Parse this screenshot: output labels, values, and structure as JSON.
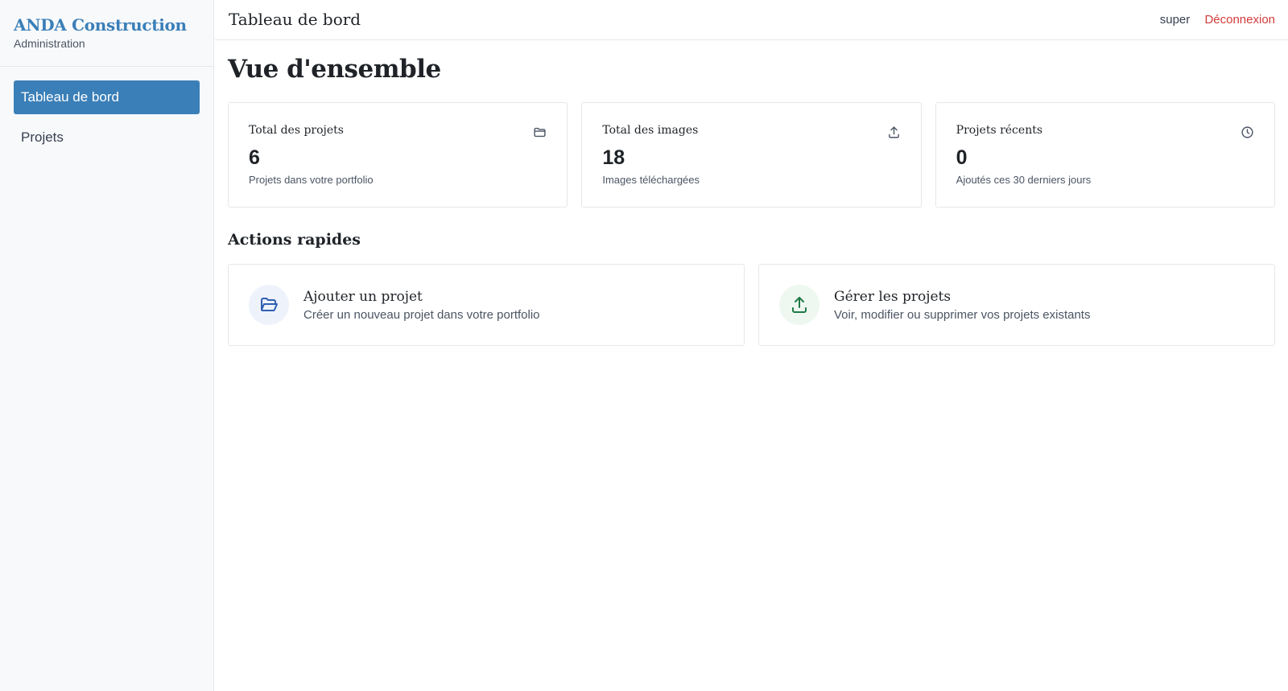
{
  "sidebar": {
    "brand_name": "ANDA Construction",
    "brand_subtitle": "Administration",
    "items": [
      {
        "label": "Tableau de bord",
        "active": true
      },
      {
        "label": "Projets",
        "active": false
      }
    ]
  },
  "header": {
    "title": "Tableau de bord",
    "user": "super",
    "logout_label": "Déconnexion"
  },
  "main": {
    "page_title": "Vue d'ensemble",
    "stats": [
      {
        "label": "Total des projets",
        "value": "6",
        "caption": "Projets dans votre portfolio",
        "icon": "folder-icon"
      },
      {
        "label": "Total des images",
        "value": "18",
        "caption": "Images téléchargées",
        "icon": "upload-icon"
      },
      {
        "label": "Projets récents",
        "value": "0",
        "caption": "Ajoutés ces 30 derniers jours",
        "icon": "clock-icon"
      }
    ],
    "quick_actions_title": "Actions rapides",
    "actions": [
      {
        "title": "Ajouter un projet",
        "description": "Créer un nouveau projet dans votre portfolio",
        "icon": "folder-open-icon"
      },
      {
        "title": "Gérer les projets",
        "description": "Voir, modifier ou supprimer vos projets existants",
        "icon": "upload-icon"
      }
    ]
  },
  "colors": {
    "accent": "#3a7fb8",
    "logout": "#d23a3a",
    "action_blue": "#2f5fb3",
    "action_green": "#1f7a45"
  }
}
